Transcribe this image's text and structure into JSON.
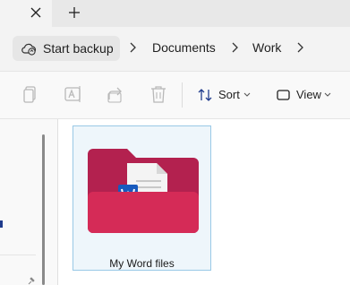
{
  "tabs": {
    "close_icon": "close-icon",
    "new_tab_icon": "plus-icon"
  },
  "address": {
    "backup_label": "Start backup",
    "backup_icon": "cloud-backup-icon",
    "crumbs": [
      "Documents",
      "Work"
    ]
  },
  "toolbar": {
    "actions": [
      "copy-icon",
      "rename-icon",
      "share-icon",
      "delete-icon"
    ],
    "sort_label": "Sort",
    "view_label": "View"
  },
  "content": {
    "items": [
      {
        "name": "My Word files",
        "type": "folder"
      }
    ]
  },
  "colors": {
    "folder_back": "#b3214f",
    "folder_front": "#d52b57",
    "word_blue": "#185abd",
    "selection": "#99c9e6"
  }
}
